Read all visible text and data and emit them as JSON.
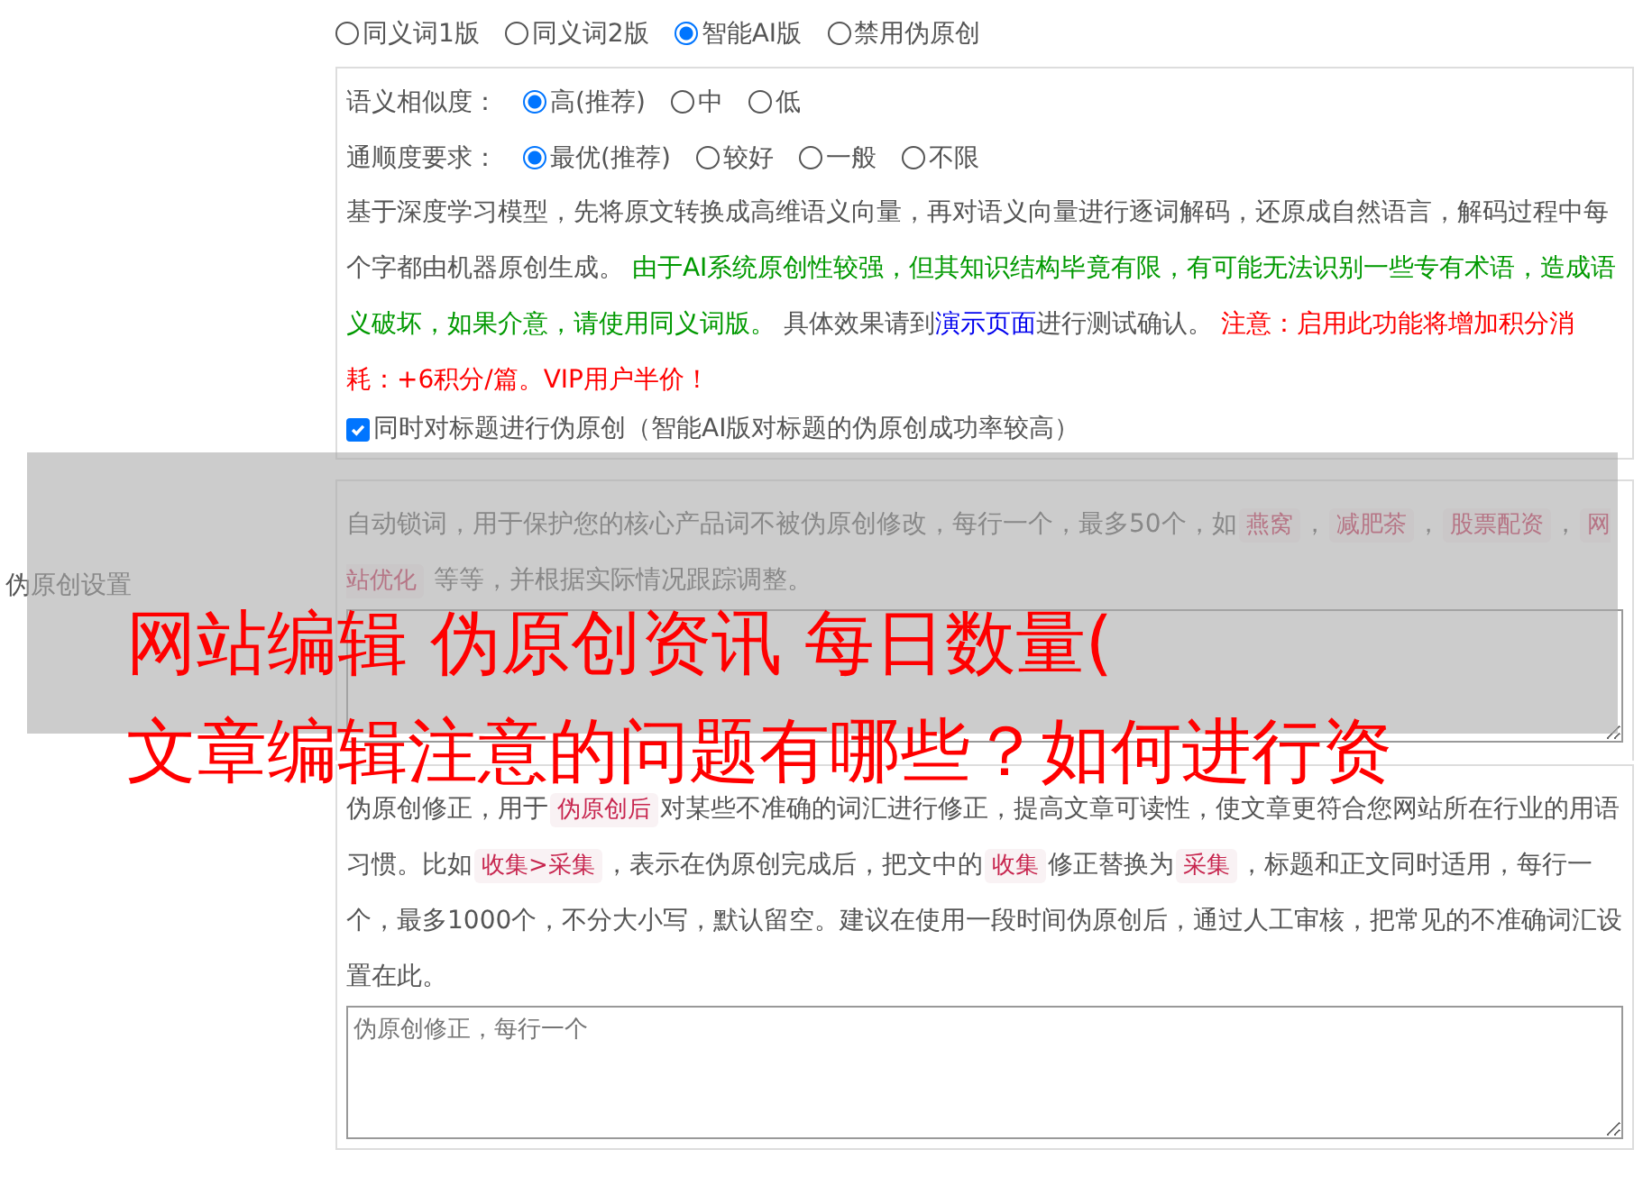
{
  "section_label": "伪原创设置",
  "mode_options": [
    {
      "label": "同义词1版",
      "selected": false
    },
    {
      "label": "同义词2版",
      "selected": false
    },
    {
      "label": "智能AI版",
      "selected": true
    },
    {
      "label": "禁用伪原创",
      "selected": false
    }
  ],
  "ai_settings": {
    "similarity": {
      "label": "语义相似度：",
      "options": [
        {
          "label": "高(推荐)",
          "selected": true
        },
        {
          "label": "中",
          "selected": false
        },
        {
          "label": "低",
          "selected": false
        }
      ]
    },
    "fluency": {
      "label": "通顺度要求：",
      "options": [
        {
          "label": "最优(推荐)",
          "selected": true
        },
        {
          "label": "较好",
          "selected": false
        },
        {
          "label": "一般",
          "selected": false
        },
        {
          "label": "不限",
          "selected": false
        }
      ]
    },
    "description": [
      {
        "kind": "text",
        "text": "基于深度学习模型，先将原文转换成高维语义向量，再对语义向量进行逐词解码，还原成自然语言，解码过程中每个字都由机器原创生成。 "
      },
      {
        "kind": "green",
        "text": "由于AI系统原创性较强，但其知识结构毕竟有限，有可能无法识别一些专有术语，造成语义破坏，如果介意，请使用同义词版。"
      },
      {
        "kind": "text",
        "text": " 具体效果请到"
      },
      {
        "kind": "link",
        "text": "演示页面"
      },
      {
        "kind": "text",
        "text": "进行测试确认。 "
      },
      {
        "kind": "warning",
        "text": "注意：启用此功能将增加积分消耗：+6积分/篇。VIP用户半价！"
      }
    ],
    "title_option": {
      "label": "同时对标题进行伪原创（智能AI版对标题的伪原创成功率较高）",
      "checked": true
    }
  },
  "lock_words": {
    "description": [
      {
        "kind": "text",
        "text": "自动锁词，用于保护您的核心产品词不被伪原创修改，每行一个，最多50个，如"
      },
      {
        "kind": "tag",
        "text": "燕窝"
      },
      {
        "kind": "text",
        "text": "，"
      },
      {
        "kind": "tag",
        "text": "减肥茶"
      },
      {
        "kind": "text",
        "text": "，"
      },
      {
        "kind": "tag",
        "text": "股票配资"
      },
      {
        "kind": "text",
        "text": "，"
      },
      {
        "kind": "tag",
        "text": "网站优化"
      },
      {
        "kind": "text",
        "text": " 等等，并根据实际情况跟踪调整。"
      }
    ]
  },
  "correction": {
    "description": [
      {
        "kind": "text",
        "text": "伪原创修正，用于"
      },
      {
        "kind": "tag",
        "text": "伪原创后"
      },
      {
        "kind": "text",
        "text": "对某些不准确的词汇进行修正，提高文章可读性，使文章更符合您网站所在行业的用语习惯。比如"
      },
      {
        "kind": "tag",
        "text": "收集>采集"
      },
      {
        "kind": "text",
        "text": "，表示在伪原创完成后，把文中的"
      },
      {
        "kind": "tag",
        "text": "收集"
      },
      {
        "kind": "text",
        "text": "修正替换为"
      },
      {
        "kind": "tag",
        "text": "采集"
      },
      {
        "kind": "text",
        "text": "，标题和正文同时适用，每行一个，最多1000个，不分大小写，默认留空。建议在使用一段时间伪原创后，通过人工审核，把常见的不准确词汇设置在此。"
      }
    ],
    "placeholder": "伪原创修正，每行一个"
  },
  "overlay": {
    "lines": [
      "网站编辑 伪原创资讯 每日数量(",
      "文章编辑注意的问题有哪些？如何进行资"
    ]
  }
}
